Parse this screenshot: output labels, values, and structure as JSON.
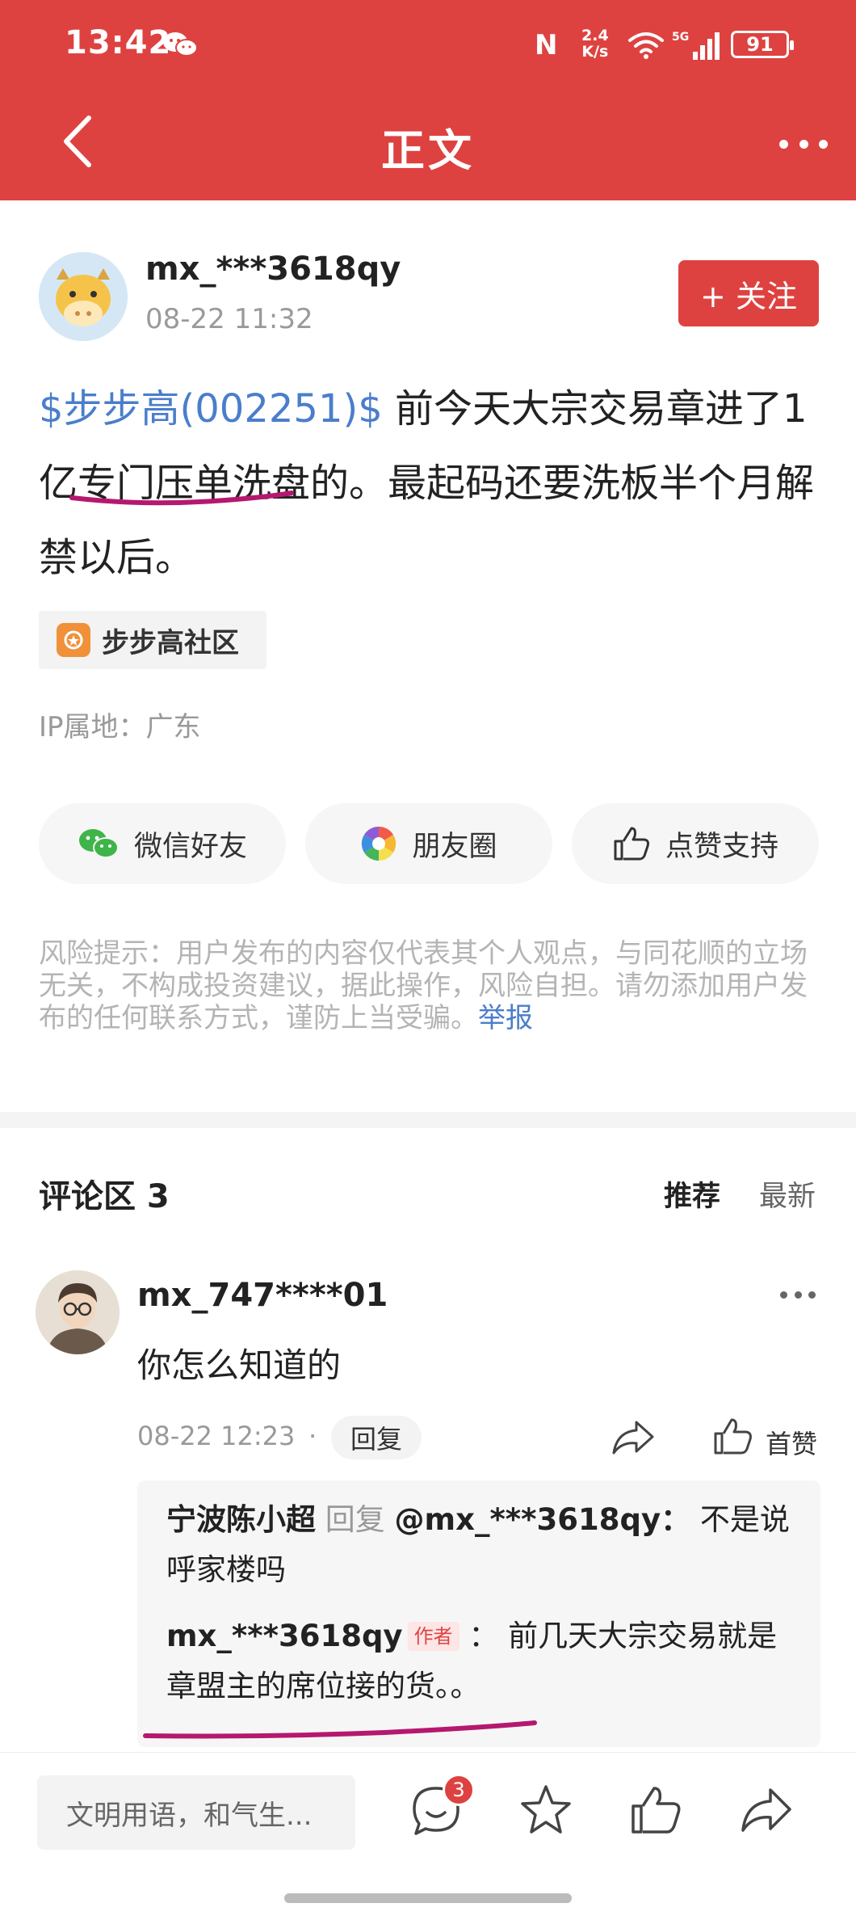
{
  "status_bar": {
    "time": "13:42",
    "network_speed_value": "2.4",
    "network_speed_unit": "K/s",
    "signal": "5G",
    "battery": "91"
  },
  "header": {
    "title": "正文"
  },
  "post": {
    "author": "mx_***3618qy",
    "time": "08-22 11:32",
    "follow_label": "+ 关注",
    "stock_tag": "$步步高(002251)$",
    "content": " 前今天大宗交易章进了1亿专门压单洗盘的。最起码还要洗板半个月解禁以后。",
    "community": "步步高社区",
    "ip_location": "IP属地：广东"
  },
  "share": {
    "wechat": "微信好友",
    "moments": "朋友圈",
    "like": "点赞支持"
  },
  "risk": {
    "text": "风险提示：用户发布的内容仅代表其个人观点，与同花顺的立场无关，不构成投资建议，据此操作，风险自担。请勿添加用户发布的任何联系方式，谨防上当受骗。",
    "report": "举报"
  },
  "comments": {
    "title": "评论区 3",
    "sort_recommended": "推荐",
    "sort_newest": "最新",
    "items": [
      {
        "user": "mx_747****01",
        "text": "你怎么知道的",
        "time": "08-22 12:23",
        "separator": "·",
        "reply_label": "回复",
        "like_label": "首赞",
        "replies": [
          {
            "user": "宁波陈小超",
            "reply_word": "回复",
            "mention": "@mx_***3618qy：",
            "text": "不是说呼家楼吗"
          },
          {
            "user": "mx_***3618qy",
            "tag": "作者",
            "colon": "：",
            "text": "前几天大宗交易就是章盟主的席位接的货。。"
          }
        ]
      }
    ]
  },
  "bottom_bar": {
    "input_placeholder": "文明用语，和气生...",
    "comment_count": "3"
  },
  "colors": {
    "brand_red": "#de4240",
    "link_blue": "#4a7ecb",
    "annotation_magenta": "#b5186f"
  }
}
